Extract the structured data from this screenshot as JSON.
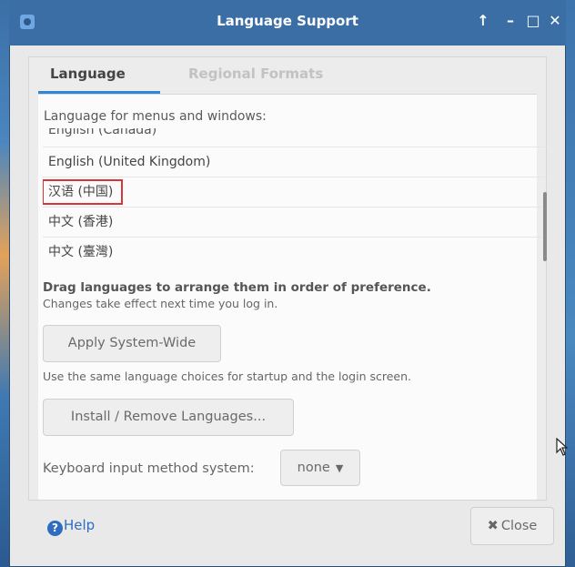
{
  "window": {
    "title": "Language Support",
    "controls": [
      "↑",
      "–",
      "□",
      "✕"
    ]
  },
  "tabs": [
    {
      "label": "Language",
      "active": true
    },
    {
      "label": "Regional Formats",
      "active": false
    }
  ],
  "language_section": {
    "label": "Language for menus and windows:",
    "items": [
      "English (Canada)",
      "English (United Kingdom)",
      "汉语 (中国)",
      "中文 (香港)",
      "中文 (臺灣)"
    ],
    "highlighted_item": "汉语 (中国)",
    "drag_hint": "Drag languages to arrange them in order of preference.",
    "change_hint": "Changes take effect next time you log in."
  },
  "buttons": {
    "apply": "Apply System-Wide",
    "install": "Install / Remove Languages...",
    "help": "Help",
    "close": "Close"
  },
  "apply_note": "Use the same language choices for startup and the login screen.",
  "keyboard": {
    "label": "Keyboard input method system:",
    "value": "none"
  },
  "colors": {
    "titlebar": "#3a6ea5",
    "tab_accent": "#2e86d6",
    "highlight_border": "#d83636",
    "help_link": "#2e6dbf"
  }
}
